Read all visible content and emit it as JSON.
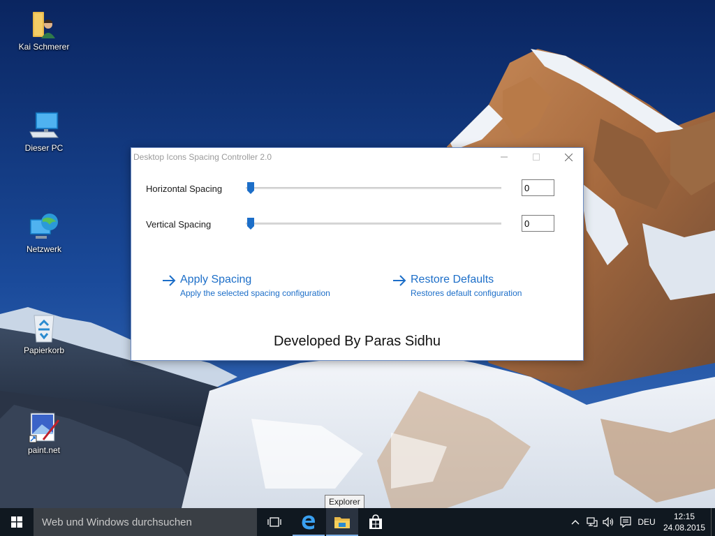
{
  "desktop": {
    "icons": [
      {
        "label": "Kai Schmerer",
        "icon": "user-folder-icon"
      },
      {
        "label": "Dieser PC",
        "icon": "computer-icon"
      },
      {
        "label": "Netzwerk",
        "icon": "network-icon"
      },
      {
        "label": "Papierkorb",
        "icon": "recycle-bin-icon"
      },
      {
        "label": "paint.net",
        "icon": "paintnet-icon"
      }
    ]
  },
  "window": {
    "title": "Desktop Icons Spacing Controller 2.0",
    "controls": [
      "minimize-icon",
      "maximize-icon",
      "close-icon"
    ],
    "horizontal": {
      "label": "Horizontal Spacing",
      "value": "0",
      "slider_value": 0
    },
    "vertical": {
      "label": "Vertical Spacing",
      "value": "0",
      "slider_value": 0
    },
    "apply": {
      "title": "Apply Spacing",
      "description": "Apply the selected spacing configuration"
    },
    "restore": {
      "title": "Restore Defaults",
      "description": "Restores default configuration"
    },
    "footer": "Developed By Paras Sidhu"
  },
  "tooltip": "Explorer",
  "taskbar": {
    "search_placeholder": "Web und Windows durchsuchen",
    "pinned": [
      "task-view-icon",
      "edge-icon",
      "file-explorer-icon",
      "store-icon"
    ],
    "tray": {
      "language": "DEU",
      "time": "12:15",
      "date": "24.08.2015"
    }
  },
  "colors": {
    "accent": "#1c6ec8",
    "taskbar": "#101820",
    "search_box": "#3a3f45"
  }
}
